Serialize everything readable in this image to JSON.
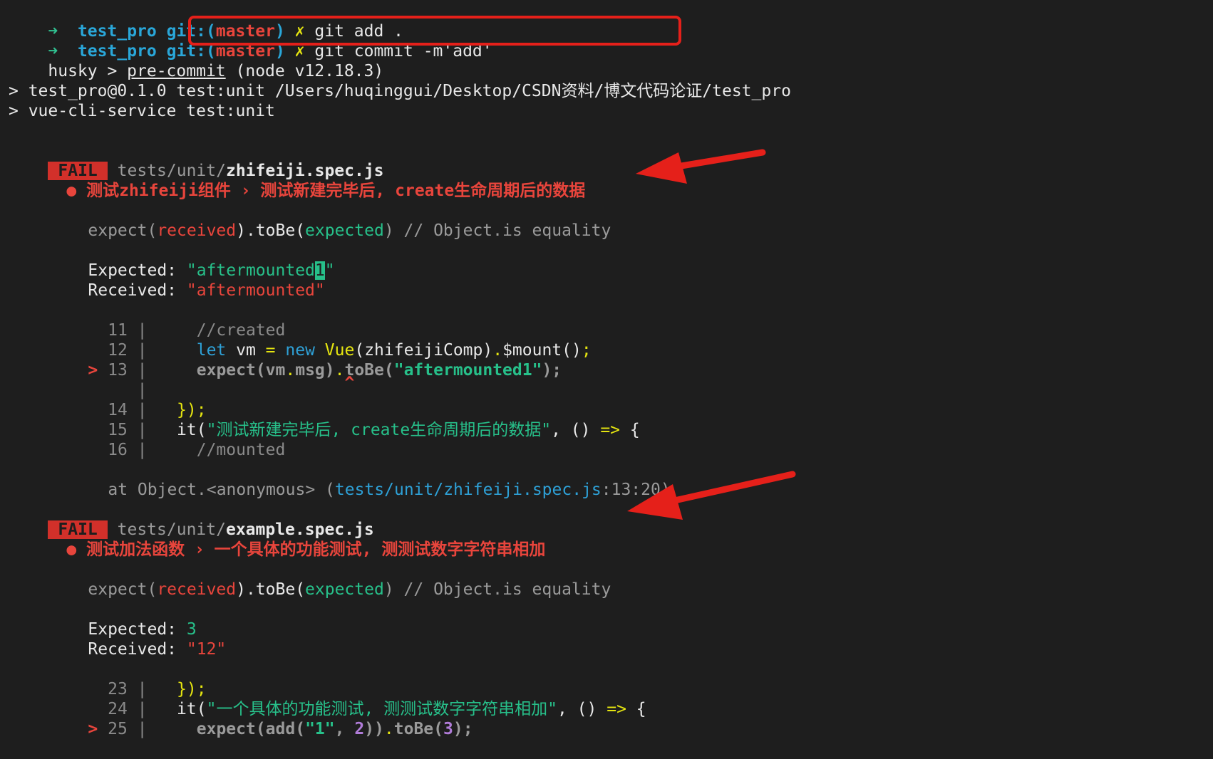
{
  "prompt": {
    "arrow": "➜",
    "dir": "test_pro",
    "git_prefix": "git:(",
    "branch": "master",
    "git_suffix": ")",
    "dirty": "✗"
  },
  "commands": {
    "line1": "git add .",
    "line2": "git commit -m'add'"
  },
  "husky": {
    "prefix": "husky > ",
    "hook": "pre-commit",
    "node": " (node v12.18.3)"
  },
  "npm": {
    "line1": "> test_pro@0.1.0 test:unit /Users/huqinggui/Desktop/CSDN资料/博文代码论证/test_pro",
    "line2": "> vue-cli-service test:unit"
  },
  "fail1": {
    "badge": "FAIL",
    "path_dir": "tests/unit/",
    "path_file": "zhifeiji.spec.js",
    "bullet": "●",
    "title": "测试zhifeiji组件 › 测试新建完毕后, create生命周期后的数据",
    "expect_open": "expect(",
    "expect_received": "received",
    "expect_tobe": ").toBe(",
    "expect_expected": "expected",
    "expect_close": ")",
    "expect_comment": " // Object.is equality",
    "expected_label": "Expected: ",
    "expected_value_pre": "\"aftermounted",
    "expected_value_diff": "1",
    "expected_value_post": "\"",
    "received_label": "Received: ",
    "received_value": "\"aftermounted\"",
    "code": {
      "l11_no": "11",
      "l11": "//created",
      "l12_no": "12",
      "l12_let": "let",
      "l12_vm": " vm ",
      "l12_eq": "=",
      "l12_new": "new",
      "l12_vue": "Vue",
      "l12_rest": "(zhifeijiComp)",
      "l12_dot": ".",
      "l12_mount": "$mount()",
      "l12_semi": ";",
      "l13_marker": ">",
      "l13_no": "13",
      "l13_a": "expect(vm",
      "l13_dot1": ".",
      "l13_b": "msg)",
      "l13_dot2": ".",
      "l13_c": "toBe(",
      "l13_str": "\"aftermounted1\"",
      "l13_d": ");",
      "caret": "^",
      "l14_no": "14",
      "l14": "});",
      "l15_no": "15",
      "l15_it": "it(",
      "l15_str": "\"测试新建完毕后, create生命周期后的数据\"",
      "l15_rest": ", () ",
      "l15_arrow": "=>",
      "l15_brace": " {",
      "l16_no": "16",
      "l16": "//mounted"
    },
    "stack_pre": "at Object.<anonymous> (",
    "stack_path": "tests/unit/zhifeiji.spec.js",
    "stack_post": ":13:20)"
  },
  "fail2": {
    "badge": "FAIL",
    "path_dir": "tests/unit/",
    "path_file": "example.spec.js",
    "bullet": "●",
    "title": "测试加法函数 › 一个具体的功能测试, 测测试数字字符串相加",
    "expect_open": "expect(",
    "expect_received": "received",
    "expect_tobe": ").toBe(",
    "expect_expected": "expected",
    "expect_close": ")",
    "expect_comment": " // Object.is equality",
    "expected_label": "Expected: ",
    "expected_value": "3",
    "received_label": "Received: ",
    "received_value": "\"12\"",
    "code": {
      "l23_no": "23",
      "l23": "});",
      "l24_no": "24",
      "l24_it": "it(",
      "l24_str": "\"一个具体的功能测试, 测测试数字字符串相加\"",
      "l24_rest": ", () ",
      "l24_arrow": "=>",
      "l24_brace": " {",
      "l25_marker": ">",
      "l25_no": "25",
      "l25_a": "expect(add(",
      "l25_str": "\"1\"",
      "l25_comma": ", ",
      "l25_num": "2",
      "l25_b": "))",
      "l25_dot": ".",
      "l25_c": "toBe(",
      "l25_num2": "3",
      "l25_d": ");"
    }
  },
  "colors": {
    "background": "#1e1e1e",
    "annotation_red": "#e5201a",
    "fail_badge": "#d2302a",
    "prompt_cyan": "#2aa7d9",
    "prompt_arrow": "#30c090"
  }
}
